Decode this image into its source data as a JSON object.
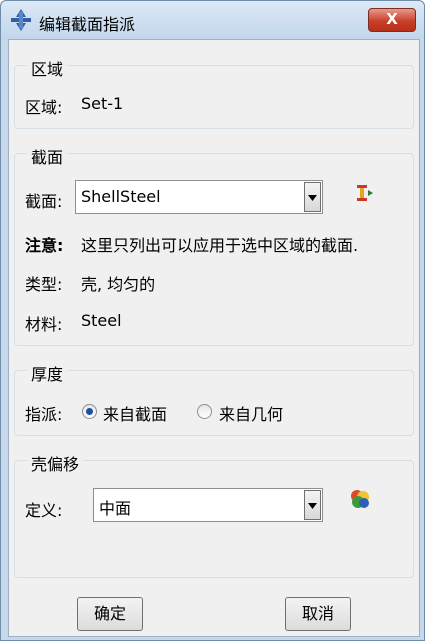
{
  "window": {
    "title": "编辑截面指派",
    "close_label": "X"
  },
  "region": {
    "legend": "区域",
    "label": "区域:",
    "value": "Set-1"
  },
  "section": {
    "legend": "截面",
    "section_label": "截面:",
    "section_value": "ShellSteel",
    "note_label": "注意:",
    "note_text": "这里只列出可以应用于选中区域的截面.",
    "type_label": "类型:",
    "type_value": "壳, 均匀的",
    "material_label": "材料:",
    "material_value": "Steel"
  },
  "thickness": {
    "legend": "厚度",
    "assign_label": "指派:",
    "options": [
      {
        "label": "来自截面",
        "selected": true
      },
      {
        "label": "来自几何",
        "selected": false
      }
    ]
  },
  "shell_offset": {
    "legend": "壳偏移",
    "definition_label": "定义:",
    "definition_value": "中面"
  },
  "buttons": {
    "ok": "确定",
    "cancel": "取消"
  },
  "icons": {
    "app": "abaqus-logo-icon",
    "section_manager": "section-manager-icon",
    "offset_visualize": "offset-color-icon"
  },
  "colors": {
    "close_button": "#c8402b",
    "radio_dot": "#1d4f9c",
    "titlebar": "#c7d8ea"
  }
}
